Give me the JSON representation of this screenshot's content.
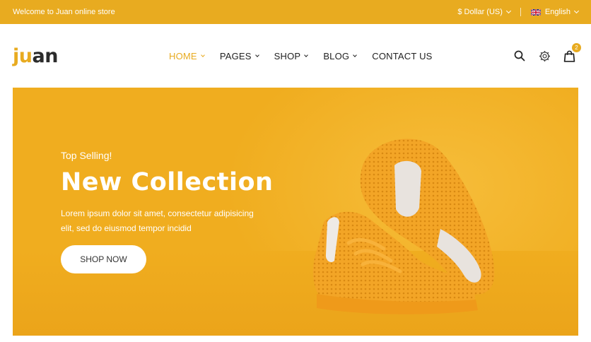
{
  "topbar": {
    "welcome": "Welcome to Juan online store",
    "currency": "$ Dollar (US)",
    "language": "English"
  },
  "logo": {
    "part1": "ju",
    "part2": "an"
  },
  "nav": {
    "items": [
      {
        "label": "HOME",
        "active": true,
        "has_dropdown": true
      },
      {
        "label": "PAGES",
        "has_dropdown": true
      },
      {
        "label": "SHOP",
        "has_dropdown": true
      },
      {
        "label": "BLOG",
        "has_dropdown": true
      },
      {
        "label": "CONTACT US",
        "has_dropdown": false
      }
    ]
  },
  "header_icons": {
    "search": "search-icon",
    "settings": "gear-icon",
    "cart": "shopping-bag-icon",
    "cart_count": "2"
  },
  "hero": {
    "subtitle": "Top Selling!",
    "title": "New Collection",
    "description": "Lorem ipsum dolor sit amet, consectetur adipisicing elit, sed do eiusmod tempor incidid",
    "button": "SHOP NOW",
    "image": "orange-sneaker"
  },
  "colors": {
    "accent": "#e8ab20",
    "hero_bg": "#f0ad1f",
    "text_dark": "#222222"
  }
}
